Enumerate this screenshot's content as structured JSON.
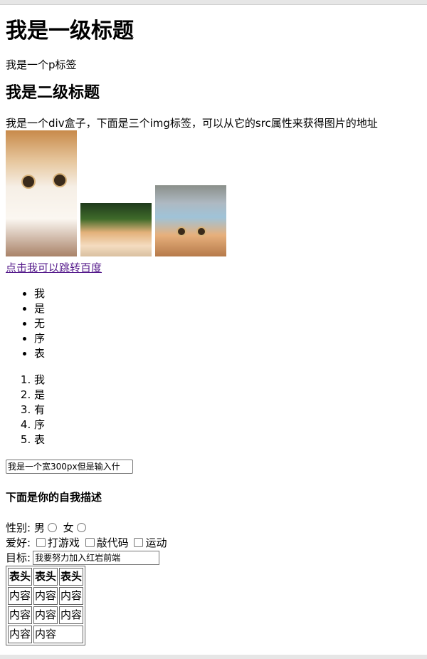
{
  "heading1": "我是一级标题",
  "paragraph": "我是一个p标签",
  "heading2": "我是二级标题",
  "div_text": "我是一个div盒子，下面是三个img标签，可以从它的src属性来获得图片的地址",
  "images": [
    "cat-image-1",
    "cat-image-2",
    "cat-image-3"
  ],
  "link_text": "点击我可以跳转百度",
  "unordered_list": [
    "我",
    "是",
    "无",
    "序",
    "表"
  ],
  "ordered_list": [
    "我",
    "是",
    "有",
    "序",
    "表"
  ],
  "text_input_value": "我是一个宽300px但是输入什",
  "self_description_heading": "下面是你的自我描述",
  "gender": {
    "label": "性别:",
    "options": [
      "男",
      "女"
    ]
  },
  "hobby": {
    "label": "爱好:",
    "options": [
      "打游戏",
      "敲代码",
      "运动"
    ]
  },
  "goal": {
    "label": "目标:",
    "value": "我要努力加入红岩前端"
  },
  "table": {
    "headers": [
      "表头",
      "表头",
      "表头"
    ],
    "rows": [
      [
        "内容",
        "内容",
        "内容"
      ],
      [
        "内容",
        "内容",
        "内容"
      ],
      [
        "内容",
        "内容"
      ]
    ]
  }
}
